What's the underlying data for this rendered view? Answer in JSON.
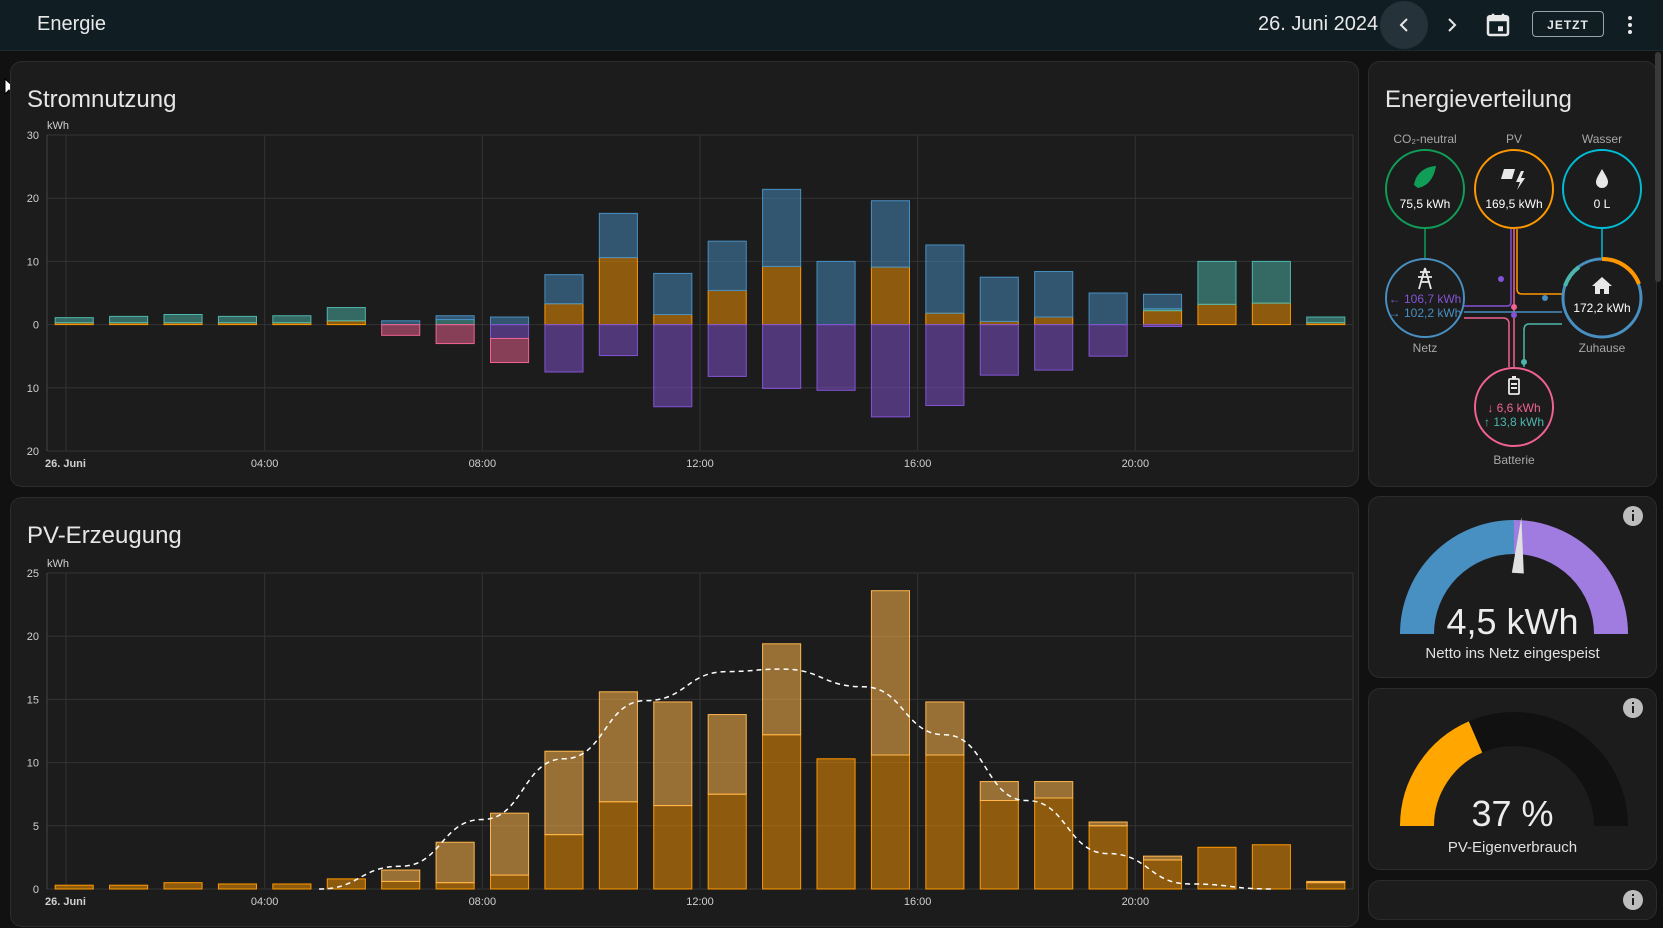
{
  "header": {
    "title": "Energie",
    "date": "26. Juni 2024",
    "now_label": "JETZT",
    "icons": [
      "chevron-left-icon",
      "chevron-right-icon",
      "calendar-icon",
      "more-vert-icon"
    ]
  },
  "colors": {
    "accent_solar": "#ff9800",
    "grid_import": "#488fc2",
    "grid_export": "#8353d4",
    "battery_in": "#f06292",
    "battery_out": "#4db6ac",
    "co2": "#0f9d58",
    "water": "#00bcd4"
  },
  "usage_card": {
    "title": "Stromnutzung",
    "unit": "kWh",
    "chart_data": {
      "type": "bar",
      "ylim": [
        -20,
        30
      ],
      "y_ticks": [
        "30",
        "20",
        "10",
        "0",
        "10",
        "20"
      ],
      "x_tick_labels": [
        "26. Juni",
        "04:00",
        "08:00",
        "12:00",
        "16:00",
        "20:00"
      ],
      "hours": [
        0,
        1,
        2,
        3,
        4,
        5,
        6,
        7,
        8,
        9,
        10,
        11,
        12,
        13,
        14,
        15,
        16,
        17,
        18,
        19,
        20,
        21,
        22,
        23
      ],
      "series": [
        {
          "key": "solar",
          "color": "#ff9800",
          "values": [
            0.3,
            0.3,
            0.3,
            0.3,
            0.3,
            0.6,
            0,
            0,
            0,
            3.3,
            10.6,
            1.6,
            5.4,
            9.2,
            0,
            9.1,
            1.8,
            0.5,
            1.2,
            0,
            2.2,
            3.2,
            3.4,
            0.3
          ]
        },
        {
          "key": "battery_out",
          "color": "#4db6ac",
          "values": [
            0.8,
            1.0,
            1.3,
            1.0,
            1.1,
            2.1,
            0,
            0.8,
            0,
            0,
            0,
            0,
            0,
            0,
            0,
            0,
            0,
            0,
            0,
            0,
            0.3,
            6.8,
            6.6,
            0.9
          ]
        },
        {
          "key": "grid",
          "color": "#488fc2",
          "values": [
            0,
            0,
            0,
            0,
            0,
            0,
            0.6,
            0.6,
            1.2,
            4.6,
            7.0,
            6.5,
            7.8,
            12.2,
            10.0,
            10.5,
            10.8,
            7.0,
            7.2,
            5.0,
            2.3,
            0,
            0,
            0
          ]
        },
        {
          "key": "grid_export",
          "color": "#8353d4",
          "values": [
            0,
            0,
            0,
            0,
            0,
            0,
            0,
            0,
            -2.2,
            -7.5,
            -4.9,
            -13.0,
            -8.2,
            -10.1,
            -10.4,
            -14.6,
            -12.8,
            -8.0,
            -7.2,
            -5.0,
            -0.3,
            0,
            0,
            0
          ]
        },
        {
          "key": "battery_in",
          "color": "#f06292",
          "values": [
            0,
            0,
            0,
            0,
            0,
            0,
            -1.7,
            -3.0,
            -3.8,
            0,
            0,
            0,
            0,
            0,
            0,
            0,
            0,
            0,
            0,
            0,
            0,
            0,
            0,
            0
          ]
        }
      ]
    }
  },
  "pv_card": {
    "title": "PV-Erzeugung",
    "unit": "kWh",
    "chart_data": {
      "type": "bar",
      "ylim": [
        0,
        25
      ],
      "y_ticks": [
        "25",
        "20",
        "15",
        "10",
        "5",
        "0"
      ],
      "x_tick_labels": [
        "26. Juni",
        "04:00",
        "08:00",
        "12:00",
        "16:00",
        "20:00"
      ],
      "hours": [
        0,
        1,
        2,
        3,
        4,
        5,
        6,
        7,
        8,
        9,
        10,
        11,
        12,
        13,
        14,
        15,
        16,
        17,
        18,
        19,
        20,
        21,
        22,
        23
      ],
      "series": [
        {
          "key": "array_1",
          "color": "#ff9800",
          "values": [
            0.3,
            0.3,
            0.5,
            0.4,
            0.4,
            0.8,
            0.6,
            0.5,
            1.1,
            4.3,
            6.9,
            6.6,
            7.5,
            12.2,
            10.3,
            10.6,
            10.6,
            7.0,
            7.2,
            5.0,
            2.3,
            3.3,
            3.5,
            0.5
          ]
        },
        {
          "key": "array_2",
          "color": "#ffb74d",
          "values": [
            0,
            0,
            0,
            0,
            0,
            0,
            0.9,
            3.2,
            4.9,
            6.6,
            8.7,
            8.2,
            6.3,
            7.2,
            0,
            13.0,
            4.2,
            1.5,
            1.3,
            0.3,
            0.3,
            0,
            0,
            0.1
          ]
        },
        {
          "key": "forecast",
          "type": "line",
          "color": "#ffffff",
          "x": [
            5.0,
            6.5,
            8.0,
            9.5,
            11.0,
            12.5,
            13.5,
            15.0,
            16.5,
            18.0,
            19.5,
            21.0,
            22.5
          ],
          "values": [
            0,
            1.8,
            5.5,
            10.3,
            14.9,
            17.2,
            17.4,
            16.0,
            12.2,
            7.0,
            2.8,
            0.4,
            0
          ]
        }
      ]
    }
  },
  "distribution_card": {
    "title": "Energieverteilung",
    "nodes": {
      "co2": {
        "label": "CO₂-neutral",
        "value": "75,5 kWh",
        "icon": "leaf-icon"
      },
      "solar": {
        "label": "PV",
        "value": "169,5 kWh",
        "icon": "solar-power-icon"
      },
      "water": {
        "label": "Wasser",
        "value": "0 L",
        "icon": "water-drop-icon"
      },
      "grid": {
        "label": "Netz",
        "import": "106,7 kWh",
        "export": "102,2 kWh",
        "icon": "transmission-tower-icon"
      },
      "home": {
        "label": "Zuhause",
        "value": "172,2 kWh",
        "icon": "home-icon"
      },
      "battery": {
        "label": "Batterie",
        "in": "6,6 kWh",
        "out": "13,8 kWh",
        "icon": "battery-icon"
      }
    }
  },
  "grid_gauge": {
    "value": "4,5 kWh",
    "label": "Netto ins Netz eingespeist",
    "needle_fraction": 0.02
  },
  "self_consumption_gauge": {
    "value": "37 %",
    "label": "PV-Eigenverbrauch",
    "fraction": 0.37
  }
}
